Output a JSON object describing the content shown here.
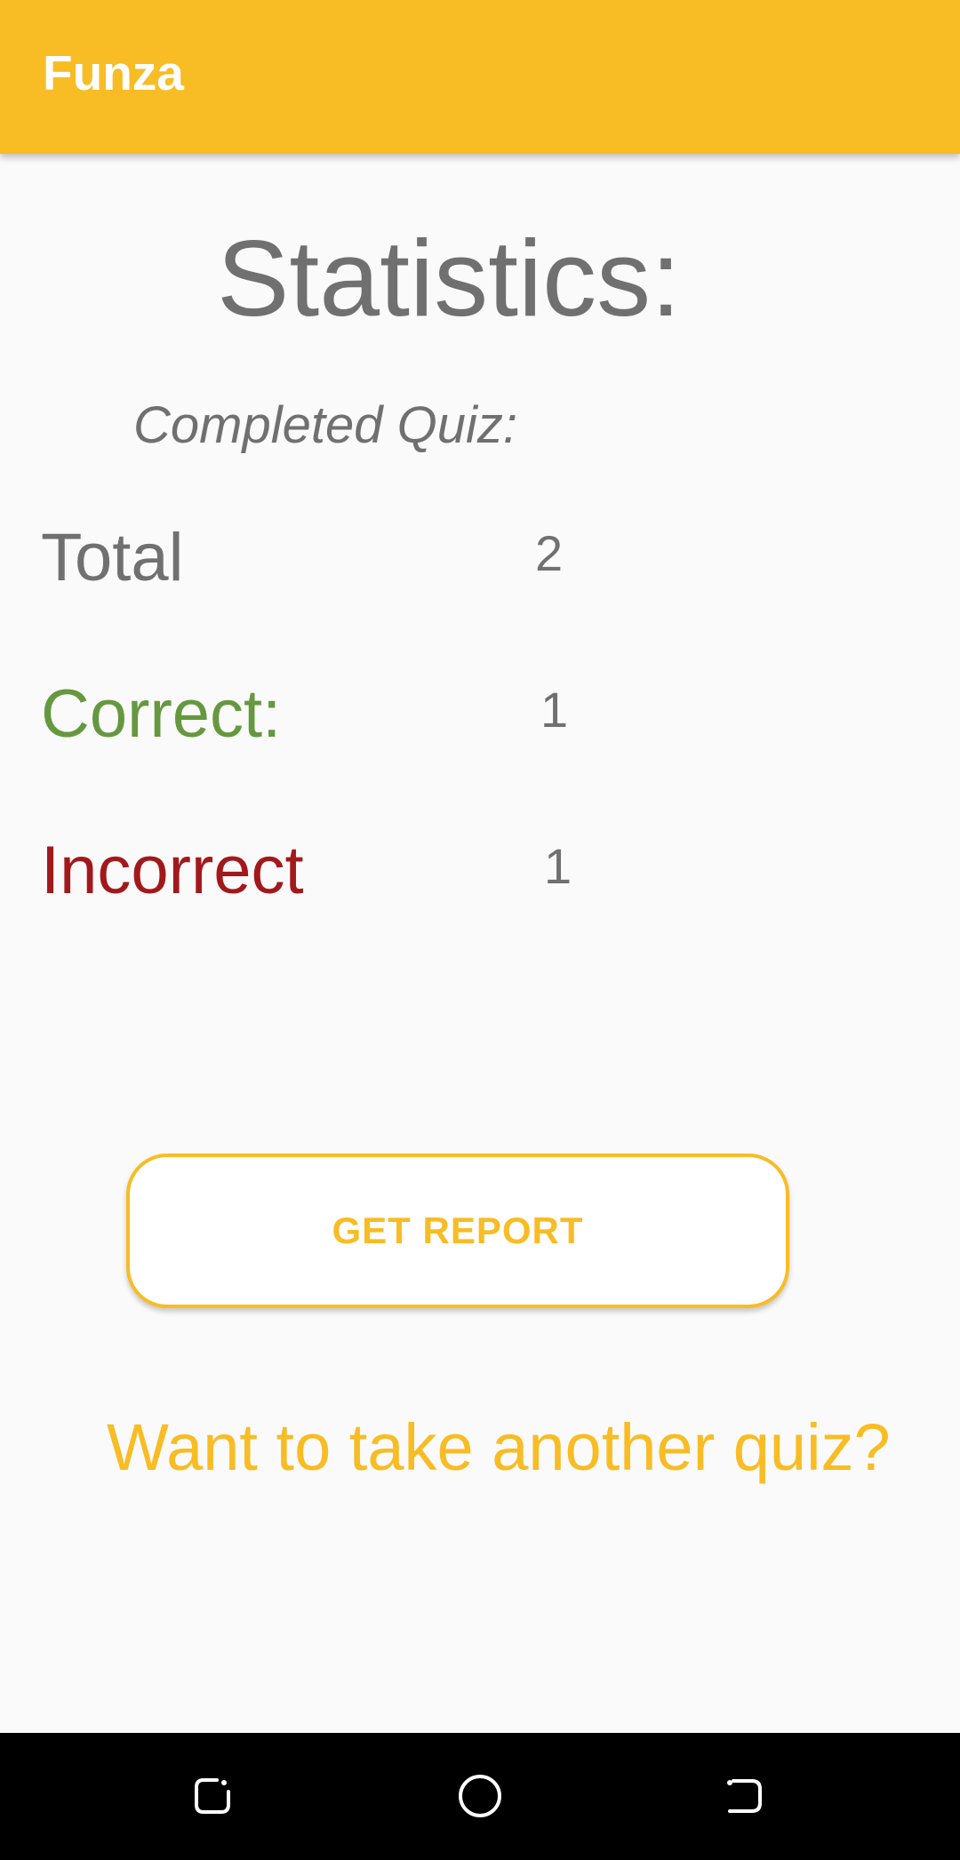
{
  "app_bar": {
    "title": "Funza"
  },
  "page": {
    "heading": "Statistics:",
    "subheading": "Completed Quiz:"
  },
  "stats": {
    "total_label": "Total",
    "total_value": "2",
    "correct_label": "Correct:",
    "correct_value": "1",
    "incorrect_label": "Incorrect",
    "incorrect_value": "1"
  },
  "actions": {
    "report_button_label": "GET REPORT",
    "another_quiz_link": "Want to take another quiz?"
  },
  "nav_bar": {
    "icons": [
      "recent-apps-icon",
      "home-icon",
      "back-icon"
    ]
  },
  "colors": {
    "accent": "#f8bc24",
    "correct": "#66983f",
    "incorrect": "#a1191c",
    "text_gray": "#707070"
  }
}
